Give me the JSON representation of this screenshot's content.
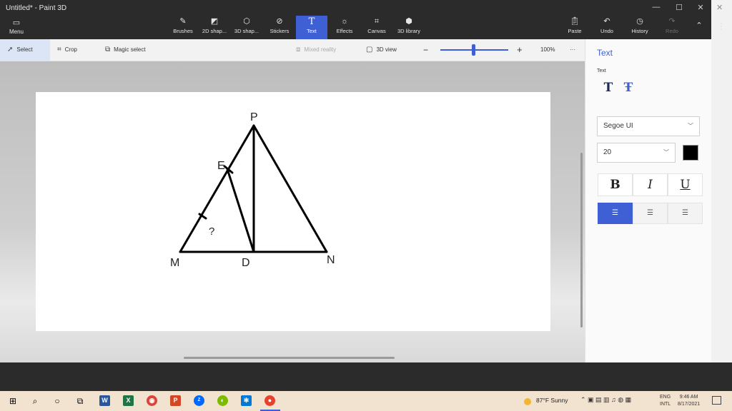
{
  "window": {
    "title": "Untitled* - Paint 3D",
    "minimize": "—",
    "maximize": "☐",
    "close": "✕",
    "outer_close": "✕"
  },
  "ribbon": {
    "menu": "Menu",
    "items": [
      {
        "label": "Brushes",
        "icon": "brush-icon"
      },
      {
        "label": "2D shap...",
        "icon": "2d-shapes-icon"
      },
      {
        "label": "3D shap...",
        "icon": "3d-shapes-icon"
      },
      {
        "label": "Stickers",
        "icon": "stickers-icon"
      },
      {
        "label": "Text",
        "icon": "text-icon"
      },
      {
        "label": "Effects",
        "icon": "effects-icon"
      },
      {
        "label": "Canvas",
        "icon": "canvas-icon"
      },
      {
        "label": "3D library",
        "icon": "3d-library-icon"
      }
    ],
    "right": [
      {
        "label": "Paste"
      },
      {
        "label": "Undo"
      },
      {
        "label": "History"
      },
      {
        "label": "Redo"
      }
    ],
    "active_color": "#3f5fd4"
  },
  "toolbar": {
    "select": "Select",
    "crop": "Crop",
    "magic_select": "Magic select",
    "mixed_reality": "Mixed reality",
    "view_3d": "3D view",
    "zoom": "100%",
    "more": "···"
  },
  "canvas": {
    "labels": {
      "P": "P",
      "E": "E",
      "M": "M",
      "D": "D",
      "N": "N",
      "question": "?"
    }
  },
  "panel": {
    "title": "Text",
    "subtitle": "Text",
    "font": "Segoe UI",
    "size": "20",
    "bold": "B",
    "italic": "I",
    "underline": "U",
    "text_color": "#000000"
  },
  "taskbar": {
    "weather": "87°F  Sunny",
    "lang_top": "ENG",
    "lang_bottom": "INTL",
    "time": "9:46 AM",
    "date": "8/17/2021"
  }
}
